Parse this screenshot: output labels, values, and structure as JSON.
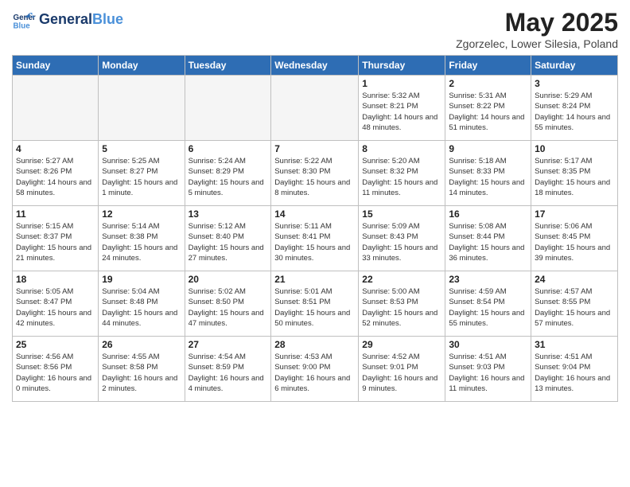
{
  "header": {
    "logo_line1": "General",
    "logo_line2": "Blue",
    "month_title": "May 2025",
    "location": "Zgorzelec, Lower Silesia, Poland"
  },
  "days_of_week": [
    "Sunday",
    "Monday",
    "Tuesday",
    "Wednesday",
    "Thursday",
    "Friday",
    "Saturday"
  ],
  "weeks": [
    [
      {
        "day": "",
        "empty": true
      },
      {
        "day": "",
        "empty": true
      },
      {
        "day": "",
        "empty": true
      },
      {
        "day": "",
        "empty": true
      },
      {
        "day": "1",
        "sunrise": "5:32 AM",
        "sunset": "8:21 PM",
        "daylight": "14 hours and 48 minutes."
      },
      {
        "day": "2",
        "sunrise": "5:31 AM",
        "sunset": "8:22 PM",
        "daylight": "14 hours and 51 minutes."
      },
      {
        "day": "3",
        "sunrise": "5:29 AM",
        "sunset": "8:24 PM",
        "daylight": "14 hours and 55 minutes."
      }
    ],
    [
      {
        "day": "4",
        "sunrise": "5:27 AM",
        "sunset": "8:26 PM",
        "daylight": "14 hours and 58 minutes."
      },
      {
        "day": "5",
        "sunrise": "5:25 AM",
        "sunset": "8:27 PM",
        "daylight": "15 hours and 1 minute."
      },
      {
        "day": "6",
        "sunrise": "5:24 AM",
        "sunset": "8:29 PM",
        "daylight": "15 hours and 5 minutes."
      },
      {
        "day": "7",
        "sunrise": "5:22 AM",
        "sunset": "8:30 PM",
        "daylight": "15 hours and 8 minutes."
      },
      {
        "day": "8",
        "sunrise": "5:20 AM",
        "sunset": "8:32 PM",
        "daylight": "15 hours and 11 minutes."
      },
      {
        "day": "9",
        "sunrise": "5:18 AM",
        "sunset": "8:33 PM",
        "daylight": "15 hours and 14 minutes."
      },
      {
        "day": "10",
        "sunrise": "5:17 AM",
        "sunset": "8:35 PM",
        "daylight": "15 hours and 18 minutes."
      }
    ],
    [
      {
        "day": "11",
        "sunrise": "5:15 AM",
        "sunset": "8:37 PM",
        "daylight": "15 hours and 21 minutes."
      },
      {
        "day": "12",
        "sunrise": "5:14 AM",
        "sunset": "8:38 PM",
        "daylight": "15 hours and 24 minutes."
      },
      {
        "day": "13",
        "sunrise": "5:12 AM",
        "sunset": "8:40 PM",
        "daylight": "15 hours and 27 minutes."
      },
      {
        "day": "14",
        "sunrise": "5:11 AM",
        "sunset": "8:41 PM",
        "daylight": "15 hours and 30 minutes."
      },
      {
        "day": "15",
        "sunrise": "5:09 AM",
        "sunset": "8:43 PM",
        "daylight": "15 hours and 33 minutes."
      },
      {
        "day": "16",
        "sunrise": "5:08 AM",
        "sunset": "8:44 PM",
        "daylight": "15 hours and 36 minutes."
      },
      {
        "day": "17",
        "sunrise": "5:06 AM",
        "sunset": "8:45 PM",
        "daylight": "15 hours and 39 minutes."
      }
    ],
    [
      {
        "day": "18",
        "sunrise": "5:05 AM",
        "sunset": "8:47 PM",
        "daylight": "15 hours and 42 minutes."
      },
      {
        "day": "19",
        "sunrise": "5:04 AM",
        "sunset": "8:48 PM",
        "daylight": "15 hours and 44 minutes."
      },
      {
        "day": "20",
        "sunrise": "5:02 AM",
        "sunset": "8:50 PM",
        "daylight": "15 hours and 47 minutes."
      },
      {
        "day": "21",
        "sunrise": "5:01 AM",
        "sunset": "8:51 PM",
        "daylight": "15 hours and 50 minutes."
      },
      {
        "day": "22",
        "sunrise": "5:00 AM",
        "sunset": "8:53 PM",
        "daylight": "15 hours and 52 minutes."
      },
      {
        "day": "23",
        "sunrise": "4:59 AM",
        "sunset": "8:54 PM",
        "daylight": "15 hours and 55 minutes."
      },
      {
        "day": "24",
        "sunrise": "4:57 AM",
        "sunset": "8:55 PM",
        "daylight": "15 hours and 57 minutes."
      }
    ],
    [
      {
        "day": "25",
        "sunrise": "4:56 AM",
        "sunset": "8:56 PM",
        "daylight": "16 hours and 0 minutes."
      },
      {
        "day": "26",
        "sunrise": "4:55 AM",
        "sunset": "8:58 PM",
        "daylight": "16 hours and 2 minutes."
      },
      {
        "day": "27",
        "sunrise": "4:54 AM",
        "sunset": "8:59 PM",
        "daylight": "16 hours and 4 minutes."
      },
      {
        "day": "28",
        "sunrise": "4:53 AM",
        "sunset": "9:00 PM",
        "daylight": "16 hours and 6 minutes."
      },
      {
        "day": "29",
        "sunrise": "4:52 AM",
        "sunset": "9:01 PM",
        "daylight": "16 hours and 9 minutes."
      },
      {
        "day": "30",
        "sunrise": "4:51 AM",
        "sunset": "9:03 PM",
        "daylight": "16 hours and 11 minutes."
      },
      {
        "day": "31",
        "sunrise": "4:51 AM",
        "sunset": "9:04 PM",
        "daylight": "16 hours and 13 minutes."
      }
    ]
  ],
  "labels": {
    "sunrise_prefix": "Sunrise: ",
    "sunset_prefix": "Sunset: ",
    "daylight_prefix": "Daylight: "
  }
}
